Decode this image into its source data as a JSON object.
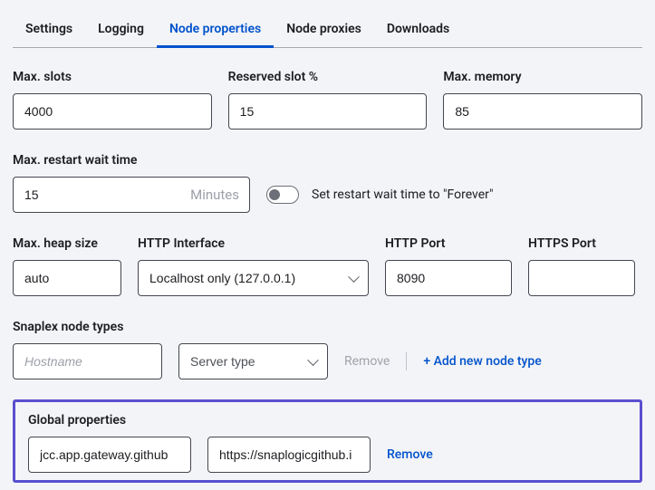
{
  "tabs": {
    "settings": "Settings",
    "logging": "Logging",
    "nodeProperties": "Node properties",
    "nodeProxies": "Node proxies",
    "downloads": "Downloads"
  },
  "fields": {
    "maxSlots": {
      "label": "Max. slots",
      "value": "4000"
    },
    "reservedSlot": {
      "label": "Reserved slot %",
      "value": "15"
    },
    "maxMemory": {
      "label": "Max. memory",
      "value": "85"
    },
    "restartWait": {
      "label": "Max. restart wait time",
      "value": "15",
      "unit": "Minutes"
    },
    "restartToggle": {
      "label": "Set restart wait time to \"Forever\""
    },
    "maxHeap": {
      "label": "Max. heap size",
      "value": "auto"
    },
    "httpInterface": {
      "label": "HTTP Interface",
      "value": "Localhost only (127.0.0.1)"
    },
    "httpPort": {
      "label": "HTTP Port",
      "value": "8090"
    },
    "httpsPort": {
      "label": "HTTPS Port",
      "value": ""
    }
  },
  "snaplex": {
    "label": "Snaplex node types",
    "hostnamePlaceholder": "Hostname",
    "serverTypePlaceholder": "Server type",
    "removeLabel": "Remove",
    "addLabel": "+ Add new node type"
  },
  "globalProps": {
    "label": "Global properties",
    "key": "jcc.app.gateway.github",
    "value": "https://snaplogicgithub.i",
    "removeLabel": "Remove"
  }
}
